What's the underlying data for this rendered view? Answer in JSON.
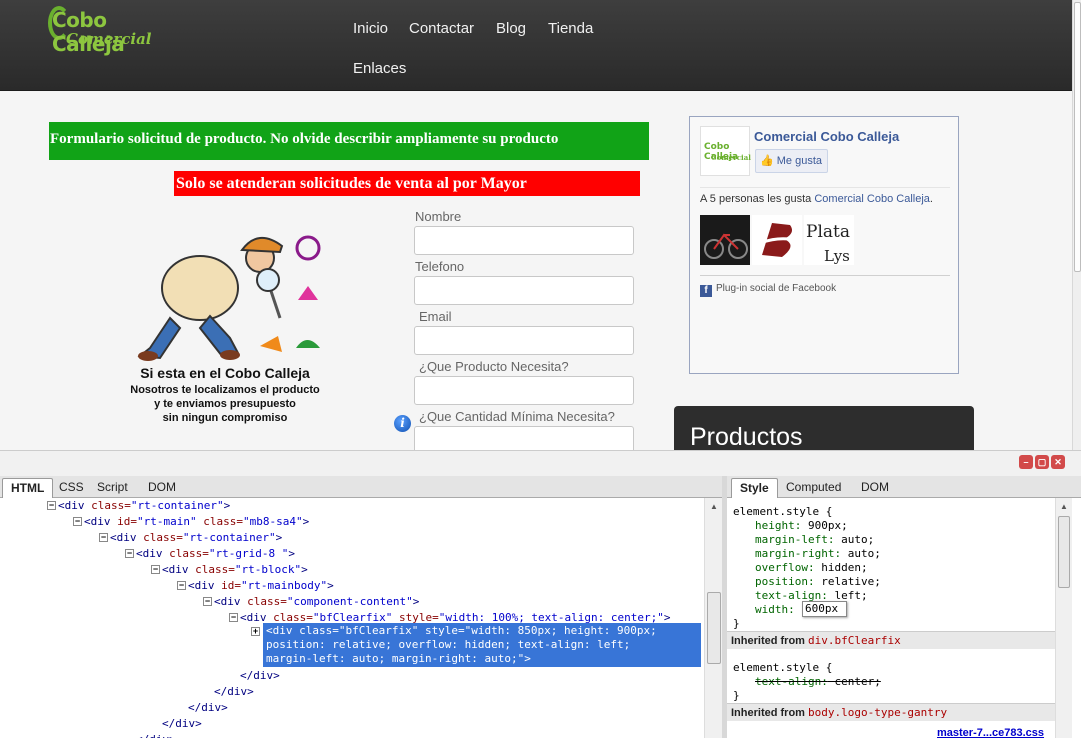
{
  "site": {
    "logo_line1": "Cobo Calleja",
    "logo_line2": "Comercial",
    "nav": [
      "Inicio",
      "Contactar",
      "Blog",
      "Tienda",
      "Enlaces"
    ],
    "banner_green": "Formulario solicitud de producto. No olvide describir ampliamente su producto",
    "banner_red": "Solo se atenderan solicitudes de venta al por Mayor",
    "tagline_title": "Si esta en el Cobo Calleja",
    "tagline_body": [
      "Nosotros te localizamos el producto",
      "y te enviamos presupuesto",
      "sin ningun compromiso"
    ],
    "form_labels": [
      "Nombre",
      "Telefono",
      "Email",
      "¿Que Producto Necesita?",
      "¿Que Cantidad Mínima Necesita?"
    ],
    "facebook": {
      "page_name": "Comercial Cobo Calleja",
      "like_button": "Me gusta",
      "count_text": "A 5 personas les gusta ",
      "count_link": "Comercial Cobo Calleja",
      "plugin_text": "Plug-in social de Facebook"
    },
    "productos_title": "Productos",
    "colors": {
      "green_banner": "#11a317",
      "red_banner": "#ff0000",
      "header": "#333333"
    }
  },
  "firebug": {
    "left_tabs": [
      "HTML",
      "CSS",
      "Script",
      "DOM"
    ],
    "right_tabs": [
      "Style",
      "Computed",
      "DOM"
    ],
    "html_lines": [
      {
        "tag": "<div ",
        "attr": "class=",
        "val": "\"rt-container\"",
        "end": ">"
      },
      {
        "tag": "<div ",
        "attr": "id=",
        "val": "\"rt-main\"",
        "attr2": " class=",
        "val2": "\"mb8-sa4\"",
        "end": ">"
      },
      {
        "tag": "<div ",
        "attr": "class=",
        "val": "\"rt-container\"",
        "end": ">"
      },
      {
        "tag": "<div ",
        "attr": "class=",
        "val": "\"rt-grid-8 \"",
        "end": ">"
      },
      {
        "tag": "<div ",
        "attr": "class=",
        "val": "\"rt-block\"",
        "end": ">"
      },
      {
        "tag": "<div ",
        "attr": "id=",
        "val": "\"rt-mainbody\"",
        "end": ">"
      },
      {
        "tag": "<div ",
        "attr": "class=",
        "val": "\"component-content\"",
        "end": ">"
      },
      {
        "tag": "<div ",
        "attr": "class=",
        "val": "\"bfClearfix\"",
        "attr2": " style=",
        "val2": "\"width: 100%; text-align: center;\"",
        "end": ">"
      }
    ],
    "selected_lines": [
      "<div class=\"bfClearfix\" style=\"width: 850px; height: 900px;",
      "position: relative; overflow: hidden; text-align: left;",
      "margin-left: auto; margin-right: auto;\">"
    ],
    "closing_tags": [
      "</div>",
      "</div>",
      "</div>",
      "</div>",
      "</div>"
    ],
    "style_rule1_selector": "element.style {",
    "style_rule1_props": [
      {
        "name": "height",
        "value": "900px;"
      },
      {
        "name": "margin-left",
        "value": "auto;"
      },
      {
        "name": "margin-right",
        "value": "auto;"
      },
      {
        "name": "overflow",
        "value": "hidden;"
      },
      {
        "name": "position",
        "value": "relative;"
      },
      {
        "name": "text-align",
        "value": "left;"
      },
      {
        "name": "width",
        "value": ""
      }
    ],
    "width_edit_value": "600px",
    "rule_close": "}",
    "inherited1_label": "Inherited from ",
    "inherited1_selector": "div.bfClearfix",
    "style_rule2_selector": "element.style {",
    "style_rule2_prop": "text-align:",
    "style_rule2_value": "center;",
    "inherited2_label": "Inherited from ",
    "inherited2_selector": "body.logo-type-gantry",
    "source_link": "master-7...ce783.css"
  }
}
